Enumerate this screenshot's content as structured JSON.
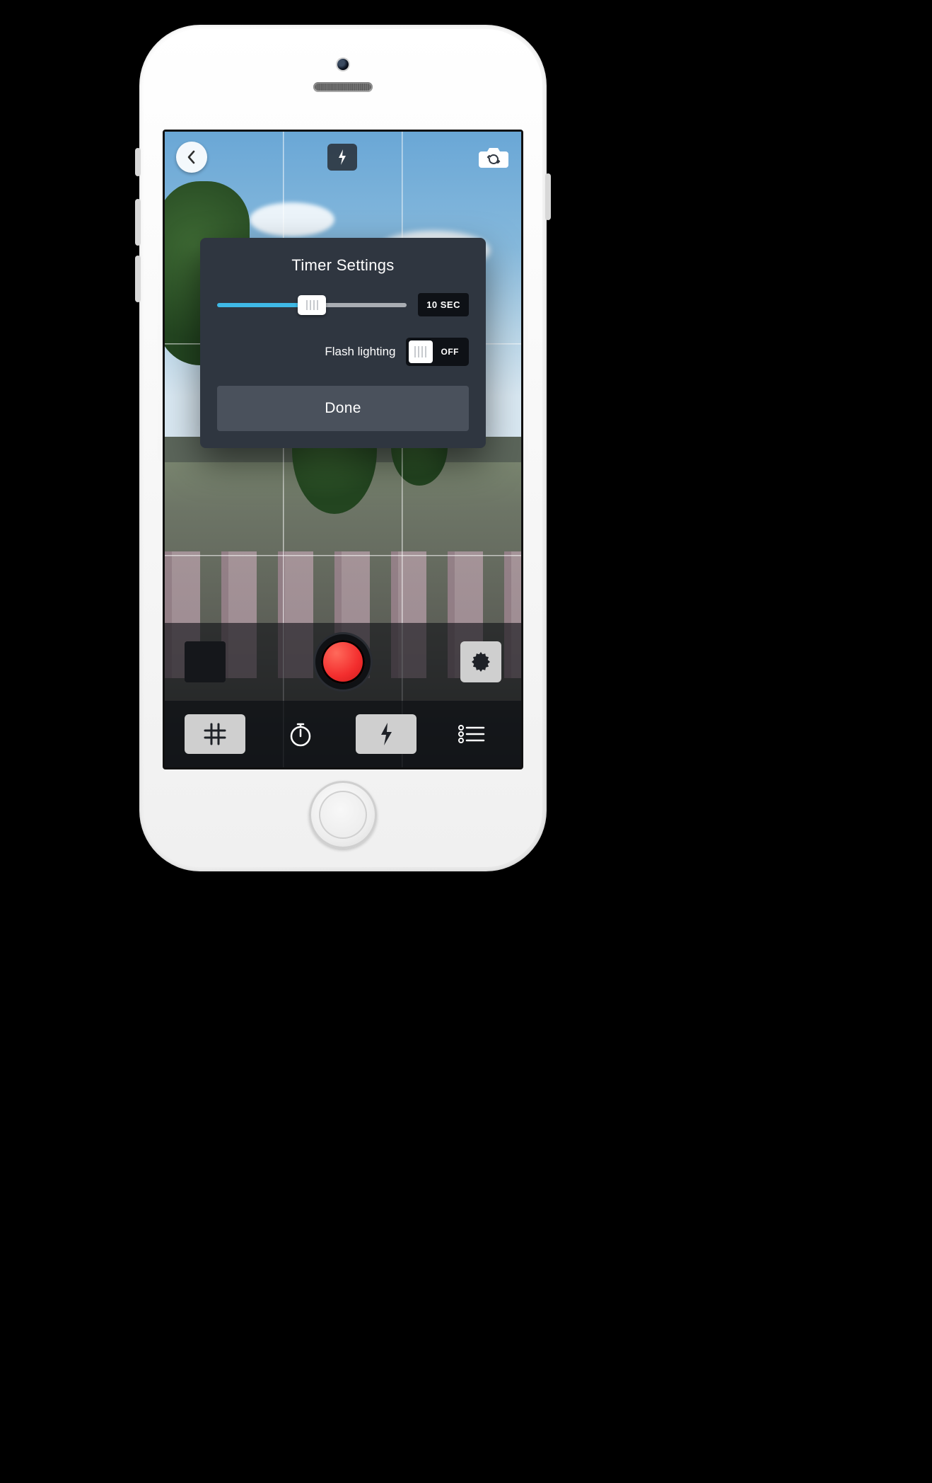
{
  "topbar": {
    "back_icon": "chevron-left-icon",
    "flash_icon": "flash-icon",
    "switch_icon": "camera-switch-icon"
  },
  "modal": {
    "title": "Timer Settings",
    "timer_value_label": "10 SEC",
    "timer_slider_percent": 50,
    "flash_label": "Flash lighting",
    "flash_toggle_state": "OFF",
    "done_label": "Done"
  },
  "capturebar": {
    "thumbnail_icon": "last-photo-thumbnail",
    "record_icon": "record-button",
    "settings_icon": "gear-icon"
  },
  "toolbar": {
    "grid_icon": "grid-icon",
    "timer_icon": "timer-icon",
    "flash_icon": "flash-icon",
    "options_icon": "options-list-icon",
    "grid_active": true,
    "flash_active": true
  }
}
